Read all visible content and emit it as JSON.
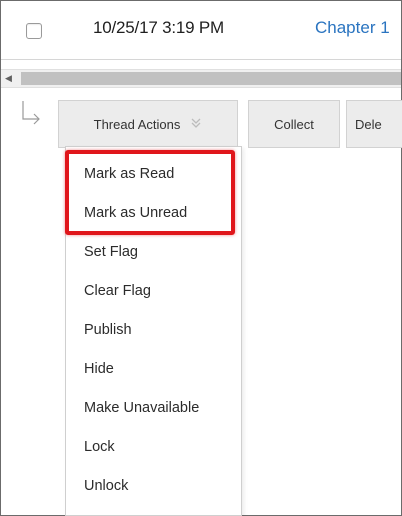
{
  "row": {
    "date": "10/25/17 3:19 PM",
    "chapter_link": "Chapter 1"
  },
  "toolbar": {
    "thread_actions_label": "Thread Actions",
    "collect_label": "Collect",
    "delete_label": "Dele"
  },
  "menu": {
    "items": [
      "Mark as Read",
      "Mark as Unread",
      "Set Flag",
      "Clear Flag",
      "Publish",
      "Hide",
      "Make Unavailable",
      "Lock",
      "Unlock"
    ]
  },
  "colors": {
    "link": "#2a74c0",
    "highlight": "#e0161b"
  },
  "icons": {
    "checkbox": "checkbox-icon",
    "scroll_left": "triangle-left-icon",
    "thread_arrow": "reply-arrow-icon",
    "chevron": "double-chevron-down-icon"
  }
}
